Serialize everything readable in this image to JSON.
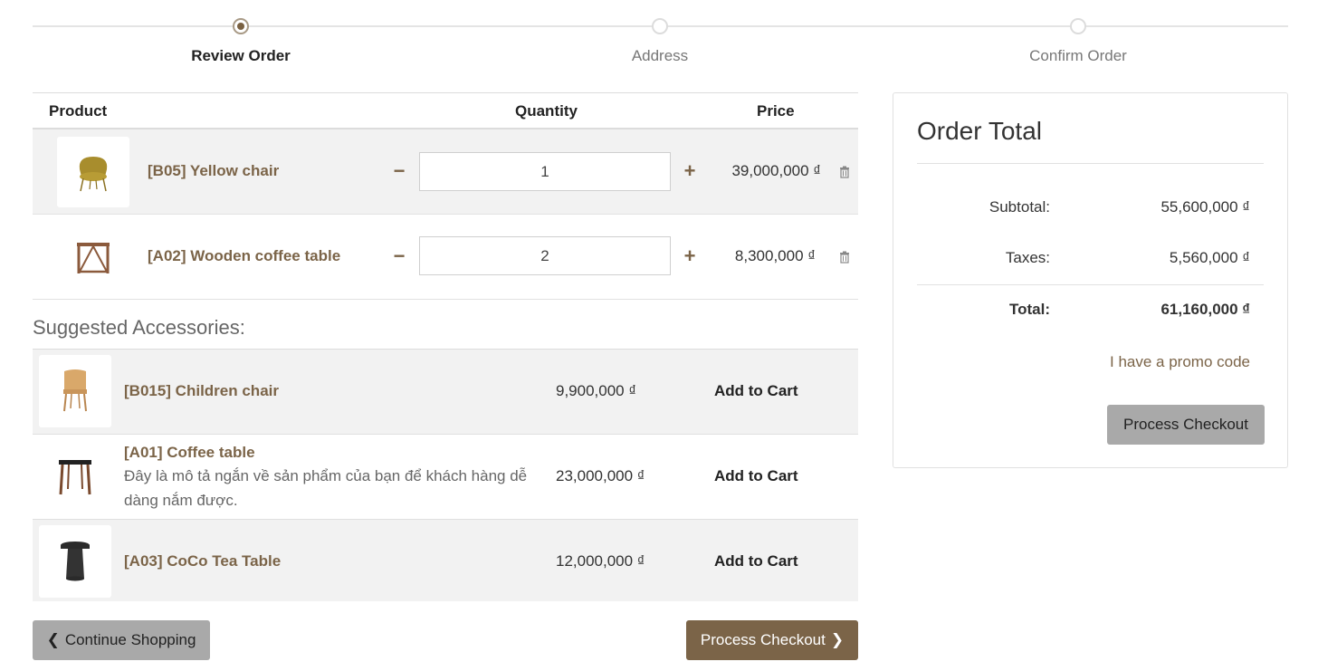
{
  "wizard": {
    "steps": [
      {
        "label": "Review Order"
      },
      {
        "label": "Address"
      },
      {
        "label": "Confirm Order"
      }
    ]
  },
  "cart": {
    "headers": {
      "product": "Product",
      "quantity": "Quantity",
      "price": "Price"
    },
    "items": [
      {
        "name": "[B05] Yellow chair",
        "qty": "1",
        "price": "39,000,000 ₫",
        "icon": "yellow-chair-thumbnail"
      },
      {
        "name": "[A02] Wooden coffee table",
        "qty": "2",
        "price": "8,300,000 ₫",
        "icon": "wooden-coffee-table-thumbnail"
      }
    ],
    "minus_symbol": "−",
    "plus_symbol": "+"
  },
  "accessories": {
    "title": "Suggested Accessories:",
    "add_label": "Add to Cart",
    "items": [
      {
        "name": "[B015] Children chair",
        "description": "",
        "price": "9,900,000 ₫"
      },
      {
        "name": "[A01] Coffee table",
        "description": "Đây là mô tả ngắn về sản phẩm của bạn để khách hàng dễ dàng nắm được.",
        "price": "23,000,000 ₫"
      },
      {
        "name": "[A03] CoCo Tea Table",
        "description": "",
        "price": "12,000,000 ₫"
      }
    ]
  },
  "buttons": {
    "continue_shopping": "Continue Shopping",
    "process_checkout": "Process Checkout"
  },
  "order_total": {
    "title": "Order Total",
    "subtotal_label": "Subtotal:",
    "subtotal_value": "55,600,000 ₫",
    "taxes_label": "Taxes:",
    "taxes_value": "5,560,000 ₫",
    "total_label": "Total:",
    "total_value": "61,160,000 ₫",
    "promo_link": "I have a promo code",
    "checkout_button": "Process Checkout"
  },
  "colors": {
    "brand": "#7b6448",
    "row_alt": "#f2f2f2",
    "secondary_button": "#a9a9a9"
  }
}
